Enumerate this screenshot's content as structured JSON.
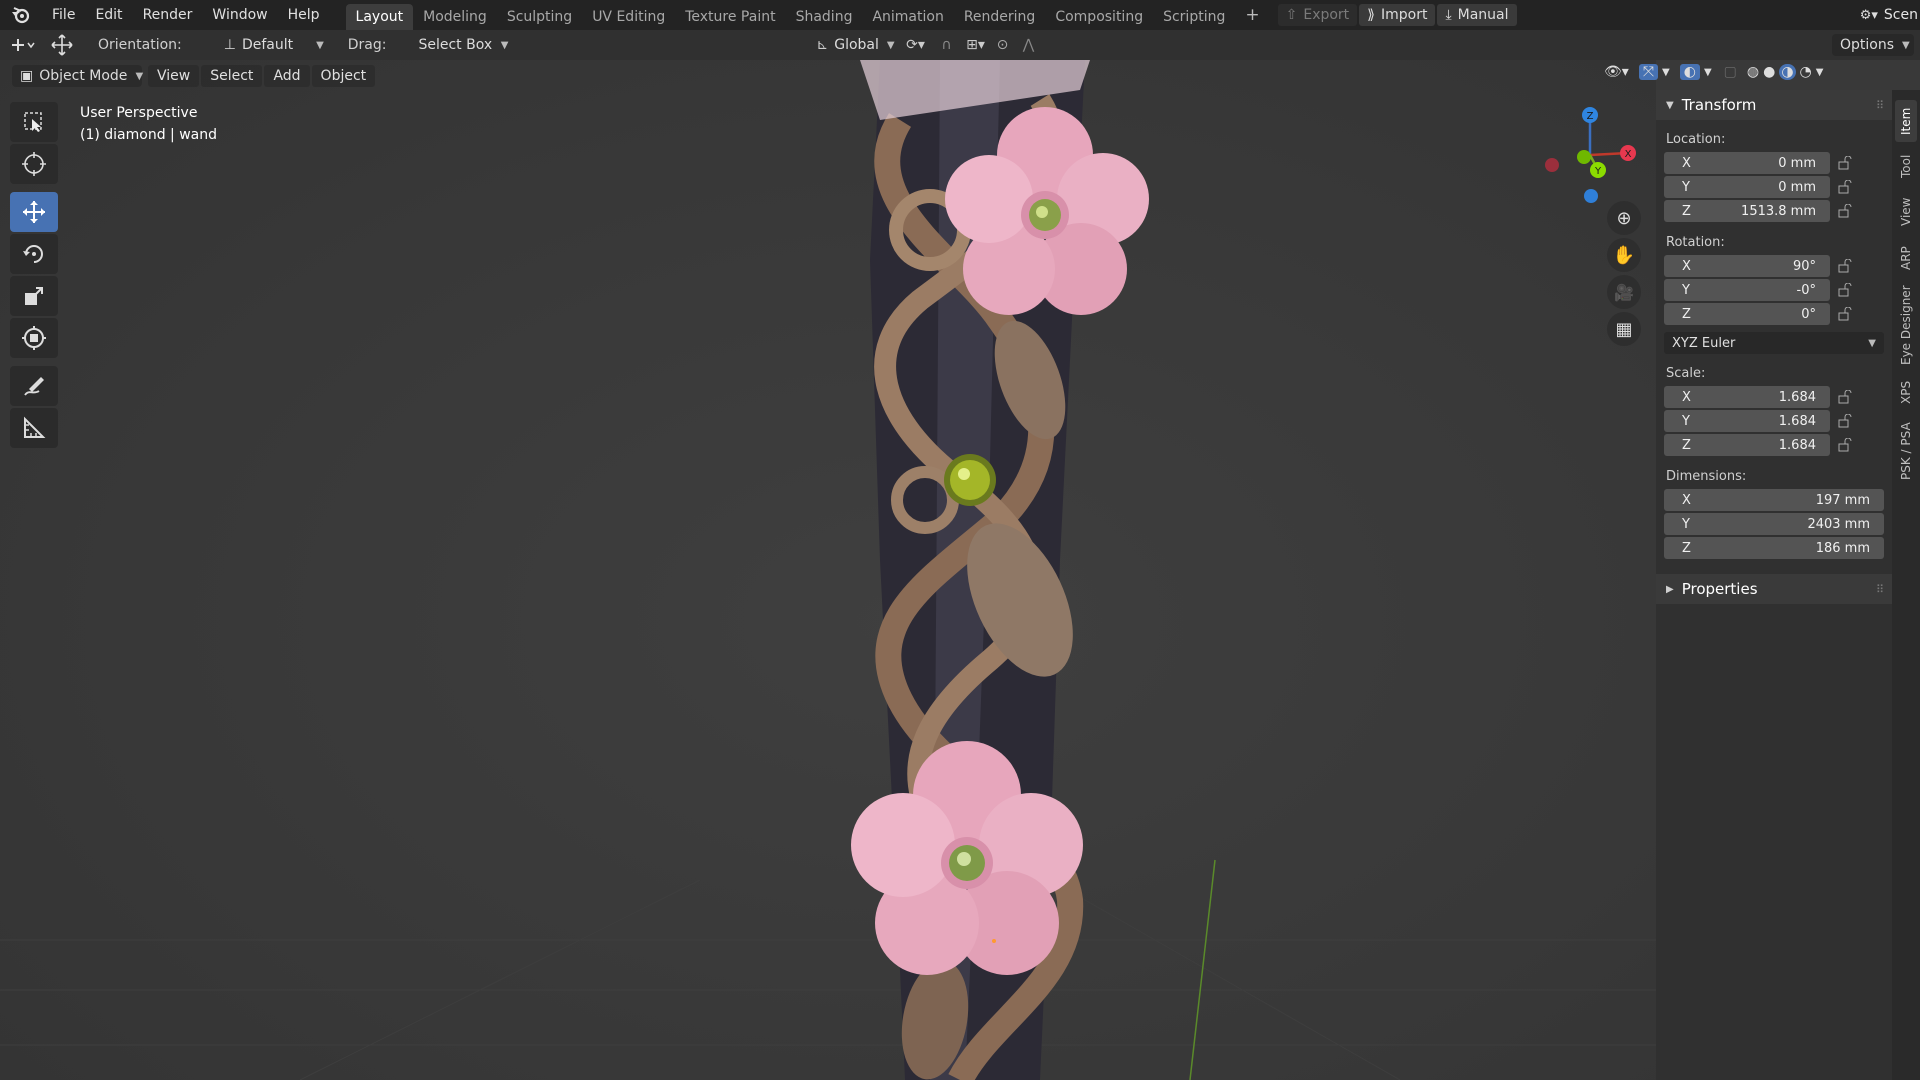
{
  "menu": {
    "items": [
      "File",
      "Edit",
      "Render",
      "Window",
      "Help"
    ]
  },
  "workspaces": {
    "tabs": [
      "Layout",
      "Modeling",
      "Sculpting",
      "UV Editing",
      "Texture Paint",
      "Shading",
      "Animation",
      "Rendering",
      "Compositing",
      "Scripting"
    ],
    "active": "Layout",
    "add_label": "+"
  },
  "addons": {
    "export_label": "Export",
    "import_label": "Import",
    "manual_label": "Manual"
  },
  "scene": {
    "label": "Scen"
  },
  "header": {
    "orientation_label": "Orientation:",
    "orientation_value": "Default",
    "drag_label": "Drag:",
    "drag_value": "Select Box",
    "transform_space": "Global",
    "options_label": "Options"
  },
  "viewport_header": {
    "mode": "Object Mode",
    "view": "View",
    "select": "Select",
    "add": "Add",
    "object": "Object"
  },
  "viewport": {
    "perspective": "User Perspective",
    "object_info": "(1) diamond | wand"
  },
  "gizmo": {
    "z": "Z",
    "x": "X",
    "y": "Y"
  },
  "npanel": {
    "transform_title": "Transform",
    "location_label": "Location:",
    "location": [
      {
        "axis": "X",
        "value": "0 mm"
      },
      {
        "axis": "Y",
        "value": "0 mm"
      },
      {
        "axis": "Z",
        "value": "1513.8 mm"
      }
    ],
    "rotation_label": "Rotation:",
    "rotation": [
      {
        "axis": "X",
        "value": "90°"
      },
      {
        "axis": "Y",
        "value": "-0°"
      },
      {
        "axis": "Z",
        "value": "0°"
      }
    ],
    "rotation_mode": "XYZ Euler",
    "scale_label": "Scale:",
    "scale": [
      {
        "axis": "X",
        "value": "1.684"
      },
      {
        "axis": "Y",
        "value": "1.684"
      },
      {
        "axis": "Z",
        "value": "1.684"
      }
    ],
    "dimensions_label": "Dimensions:",
    "dimensions": [
      {
        "axis": "X",
        "value": "197 mm"
      },
      {
        "axis": "Y",
        "value": "2403 mm"
      },
      {
        "axis": "Z",
        "value": "186 mm"
      }
    ],
    "properties_title": "Properties"
  },
  "sidetabs": [
    "Item",
    "Tool",
    "View",
    "ARP",
    "Eye Designer",
    "XPS",
    "PSK / PSA"
  ],
  "colors": {
    "accent": "#4772b3",
    "axis_x": "#e8384f",
    "axis_y": "#8bdc00",
    "axis_z": "#2f85e0"
  }
}
